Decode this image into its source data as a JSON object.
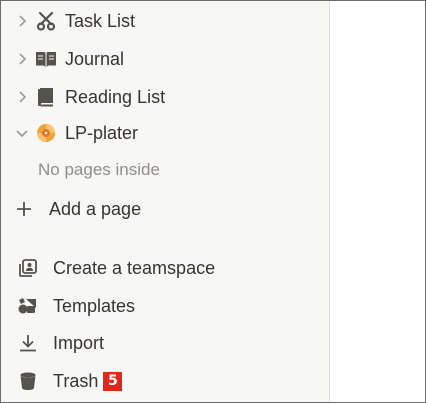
{
  "sidebar": {
    "pages": [
      {
        "label": "Task List",
        "icon": "scissors-icon",
        "expanded": false
      },
      {
        "label": "Journal",
        "icon": "open-book-icon",
        "expanded": false
      },
      {
        "label": "Reading List",
        "icon": "book-icon",
        "expanded": false
      },
      {
        "label": "LP-plater",
        "icon": "vinyl-record-icon",
        "expanded": true
      }
    ],
    "empty_text": "No pages inside",
    "add_page_label": "Add a page",
    "actions": [
      {
        "label": "Create a teamspace",
        "icon": "teamspace-icon"
      },
      {
        "label": "Templates",
        "icon": "templates-icon"
      },
      {
        "label": "Import",
        "icon": "import-icon"
      },
      {
        "label": "Trash",
        "icon": "trash-icon"
      }
    ],
    "trash_badge": "5"
  },
  "colors": {
    "text": "#37352f",
    "muted": "#8f8e8a",
    "icon": "#55534e",
    "badge": "#e1261c",
    "sidebar_bg": "#f7f7f5"
  }
}
